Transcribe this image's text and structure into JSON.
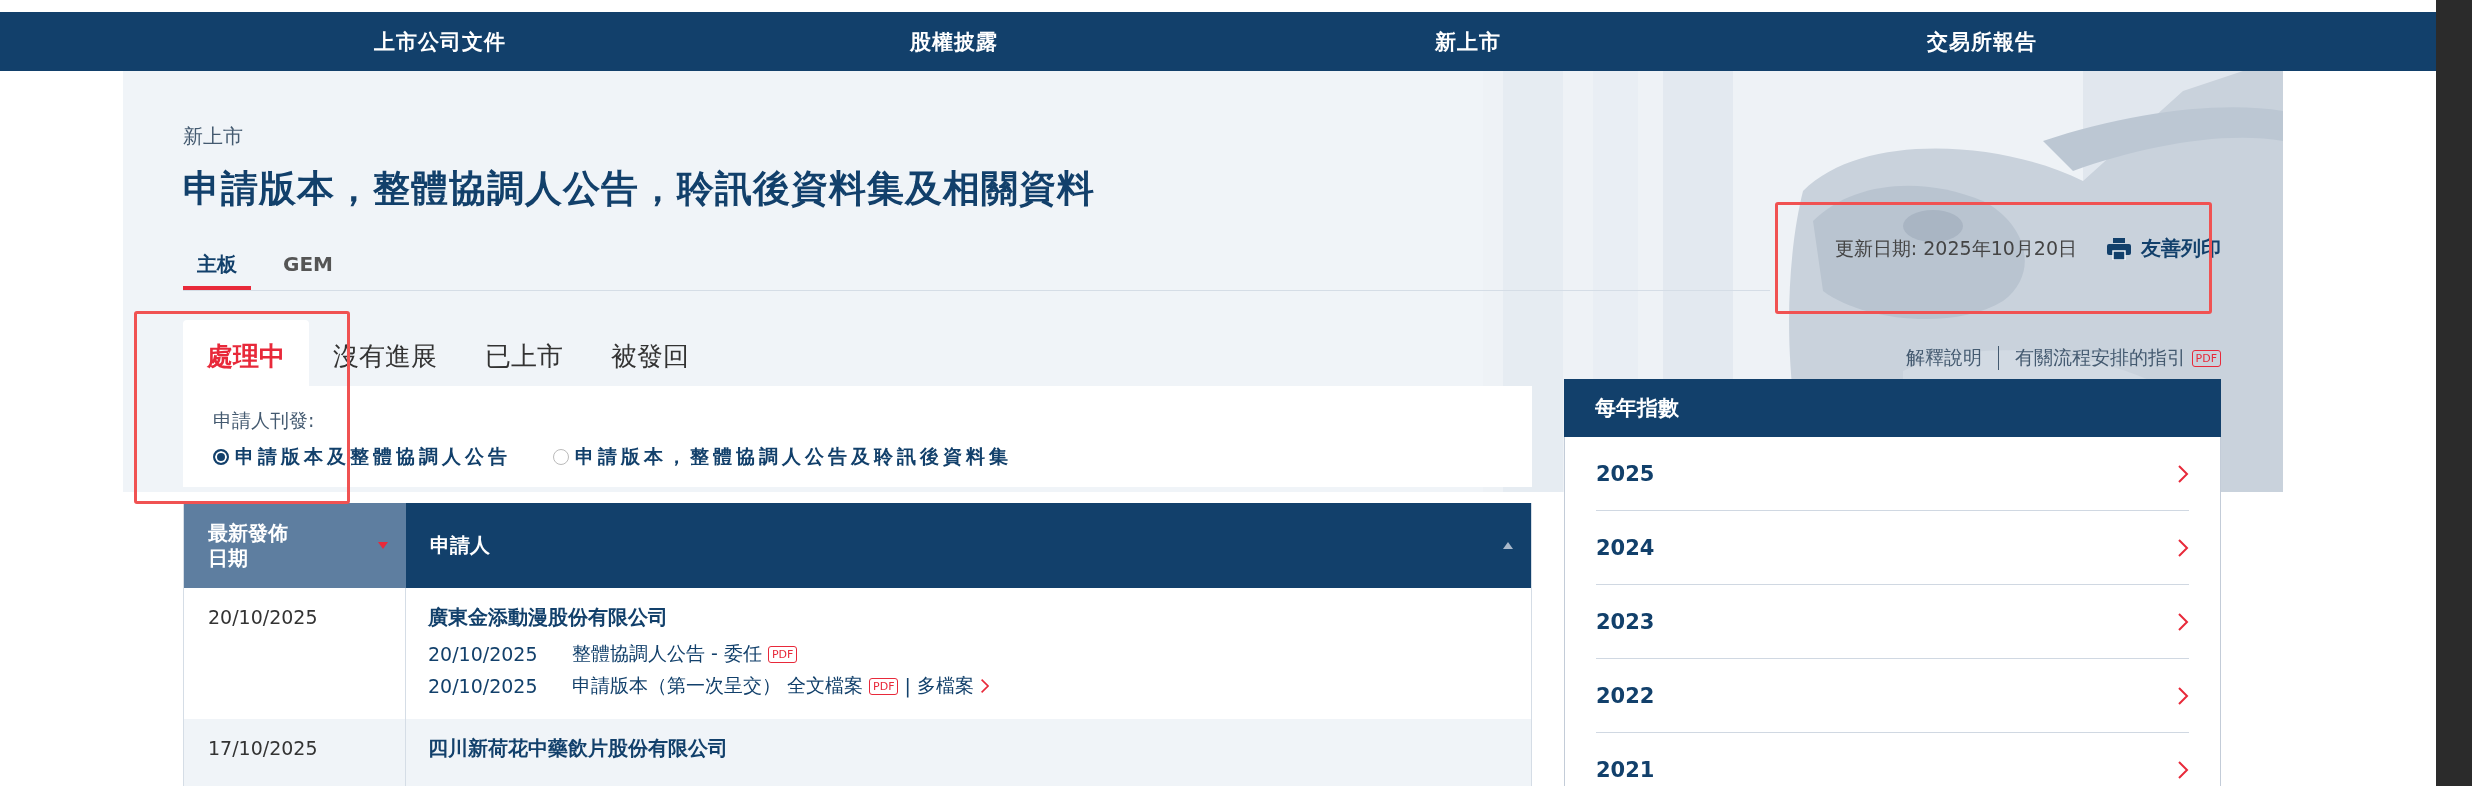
{
  "nav": [
    {
      "label": "上市公司文件"
    },
    {
      "label": "股權披露"
    },
    {
      "label": "新上市"
    },
    {
      "label": "交易所報告"
    }
  ],
  "breadcrumb": "新上市",
  "title": "申請版本，整體協調人公告，聆訊後資料集及相關資料",
  "board_tabs": [
    {
      "label": "主板",
      "selected": true
    },
    {
      "label": "GEM",
      "selected": false
    }
  ],
  "update_date": "更新日期: 2025年10月20日",
  "print_label": "友善列印",
  "status_tabs": [
    {
      "label": "處理中",
      "selected": true
    },
    {
      "label": "沒有進展",
      "selected": false
    },
    {
      "label": "已上市",
      "selected": false
    },
    {
      "label": "被發回",
      "selected": false
    }
  ],
  "filter": {
    "label": "申請人刊發:",
    "options": [
      {
        "label": "申請版本及整體協調人公告",
        "selected": true
      },
      {
        "label": "申請版本，整體協調人公告及聆訊後資料集",
        "selected": false
      }
    ]
  },
  "links": [
    {
      "label": "解釋說明"
    },
    {
      "label": "有關流程安排的指引",
      "badge": "PDF"
    }
  ],
  "table": {
    "columns": [
      {
        "lines": [
          "最新發佈",
          "日期"
        ],
        "sorted": true,
        "descending": true
      },
      {
        "lines": [
          "申請人"
        ],
        "sorted": false,
        "descending": false
      }
    ],
    "rows": [
      {
        "date": "20/10/2025",
        "applicant": "廣東金添動漫股份有限公司",
        "documents": [
          {
            "date": "20/10/2025",
            "title": "整體協調人公告 - 委任",
            "badge": "PDF"
          },
          {
            "date": "20/10/2025",
            "title": "申請版本（第一次呈交） 全文檔案",
            "badge": "PDF",
            "separator": "|",
            "more": "多檔案"
          }
        ]
      },
      {
        "date": "17/10/2025",
        "applicant": "四川新荷花中藥飲片股份有限公司"
      }
    ]
  },
  "year_index": {
    "title": "每年指數",
    "years": [
      "2025",
      "2024",
      "2023",
      "2022",
      "2021"
    ]
  }
}
